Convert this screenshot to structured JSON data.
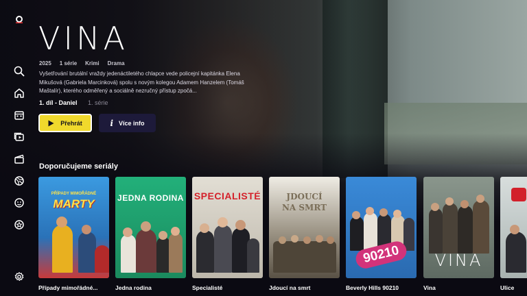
{
  "colors": {
    "background": "#0b0a12",
    "accent_yellow": "#f0d92c",
    "info_button": "#1d1a3a"
  },
  "sidebar": {
    "items": [
      {
        "icon": "search-icon"
      },
      {
        "icon": "home-icon"
      },
      {
        "icon": "calendar-icon"
      },
      {
        "icon": "series-icon",
        "active": true
      },
      {
        "icon": "movies-icon"
      },
      {
        "icon": "sport-icon"
      },
      {
        "icon": "kids-icon"
      },
      {
        "icon": "favorites-icon"
      },
      {
        "icon": "settings-icon"
      }
    ]
  },
  "hero": {
    "title": "VINA",
    "year": "2025",
    "seasons": "1 série",
    "genre1": "Krimi",
    "genre2": "Drama",
    "description": "Vyšetřování brutální vraždy jedenáctiletého chlapce vede policejní kapitánka Elena Mikušová (Gabriela Marcinková) spolu s novým kolegou Adamem Hanzelem (Tomáš Maštalír), kterého odměřený a sociálně nezručný přístup zpočá...",
    "episode": "1. díl - Daniel",
    "season": "1. série",
    "play_label": "Přehrát",
    "info_label": "Více info"
  },
  "section_title": "Doporučujeme seriály",
  "cards": [
    {
      "title": "Případy mimořádné...",
      "poster_text": "PŘÍPADY MIMOŘÁDNÉ",
      "poster_text2": "MARTY",
      "bg": "#3a8fd0"
    },
    {
      "title": "Jedna rodina",
      "poster_text": "JEDNA RODINA",
      "bg": "#1f9e6a"
    },
    {
      "title": "Specialisté",
      "poster_text": "SPECIALISTÉ",
      "bg": "#cfcac0"
    },
    {
      "title": "Jdoucí na smrt",
      "poster_text": "JDOUCÍ",
      "poster_text2": "NA SMRT",
      "bg": "#8a8478"
    },
    {
      "title": "Beverly Hills 90210",
      "poster_text": "90210",
      "bg": "#2f7fc8"
    },
    {
      "title": "Vina",
      "poster_text": "VINA",
      "bg": "#6e7a70"
    },
    {
      "title": "Ulice",
      "poster_text": "",
      "bg": "#c9cfcf"
    }
  ]
}
